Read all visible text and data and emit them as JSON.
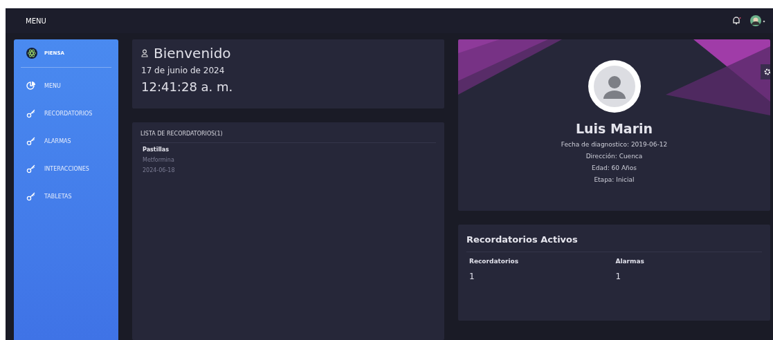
{
  "topbar": {
    "menu_label": "MENU"
  },
  "sidebar": {
    "brand": "PIENSA",
    "items": [
      {
        "label": "MENU",
        "kind": "chart"
      },
      {
        "label": "RECORDATORIOS",
        "kind": "key"
      },
      {
        "label": "ALARMAS",
        "kind": "key"
      },
      {
        "label": "INTERACCIONES",
        "kind": "key"
      },
      {
        "label": "TABLETAS",
        "kind": "key"
      }
    ]
  },
  "welcome": {
    "title": "Bienvenido",
    "date": "17 de junio de 2024",
    "time": "12:41:28 a. m."
  },
  "reminders": {
    "title": "LISTA DE RECORDATORIOS(1)",
    "items": [
      {
        "name": "Pastillas",
        "medicine": "Metformina",
        "date": "2024-06-18"
      }
    ]
  },
  "profile": {
    "name": "Luis Marin",
    "details": [
      "Fecha de diagnostico: 2019-06-12",
      "Dirección: Cuenca",
      "Edad: 60 Años",
      "Etapa: Inicial"
    ]
  },
  "active": {
    "title": "Recordatorios Activos",
    "columns": [
      {
        "label": "Recordatorios",
        "value": "1"
      },
      {
        "label": "Alarmas",
        "value": "1"
      }
    ]
  }
}
